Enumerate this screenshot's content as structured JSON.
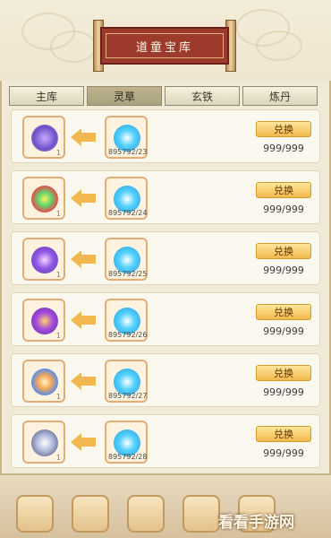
{
  "header": {
    "title": "道童宝库"
  },
  "tabs": [
    {
      "label": "主库",
      "active": false
    },
    {
      "label": "灵草",
      "active": true
    },
    {
      "label": "玄铁",
      "active": false
    },
    {
      "label": "炼丹",
      "active": false
    }
  ],
  "items": [
    {
      "reward_icon": "violet-crystal-icon",
      "cost_icon": "blue-spirit-gem-icon",
      "reward_qty": "1",
      "cost_count": "895792/23",
      "button_label": "兑换",
      "limit": "999/999"
    },
    {
      "reward_icon": "rainbow-fruit-icon",
      "cost_icon": "blue-spirit-gem-icon",
      "reward_qty": "1",
      "cost_count": "895792/24",
      "button_label": "兑换",
      "limit": "999/999"
    },
    {
      "reward_icon": "purple-mist-icon",
      "cost_icon": "blue-spirit-gem-icon",
      "reward_qty": "1",
      "cost_count": "895792/25",
      "button_label": "兑换",
      "limit": "999/999"
    },
    {
      "reward_icon": "flame-orb-icon",
      "cost_icon": "blue-spirit-gem-icon",
      "reward_qty": "1",
      "cost_count": "895792/26",
      "button_label": "兑换",
      "limit": "999/999"
    },
    {
      "reward_icon": "twin-orb-icon",
      "cost_icon": "blue-spirit-gem-icon",
      "reward_qty": "1",
      "cost_count": "895792/27",
      "button_label": "兑换",
      "limit": "999/999"
    },
    {
      "reward_icon": "moon-orb-icon",
      "cost_icon": "blue-spirit-gem-icon",
      "reward_qty": "1",
      "cost_count": "895792/28",
      "button_label": "兑换",
      "limit": "999/999"
    }
  ],
  "watermark": "看看手游网"
}
